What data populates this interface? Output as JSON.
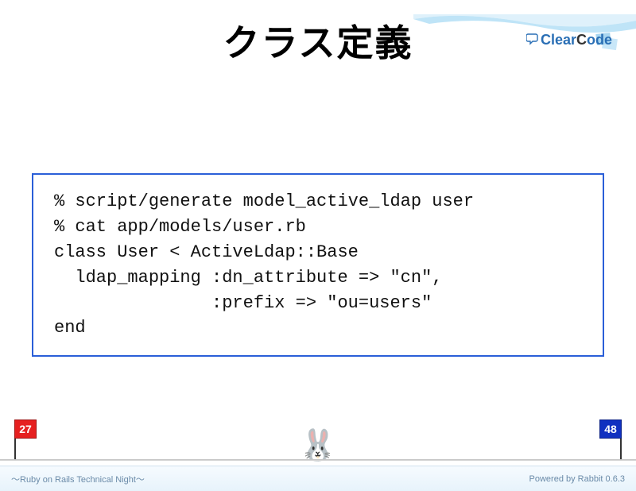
{
  "brand": {
    "name": "ClearCode"
  },
  "title": "クラス定義",
  "code": "% script/generate model_active_ldap user\n% cat app/models/user.rb\nclass User < ActiveLdap::Base\n  ldap_mapping :dn_attribute => \"cn\",\n               :prefix => \"ou=users\"\nend",
  "progress": {
    "current": "27",
    "total": "48"
  },
  "footer": {
    "left": "～Ruby on Rails Technical Night～",
    "right": "Powered by Rabbit 0.6.3"
  }
}
